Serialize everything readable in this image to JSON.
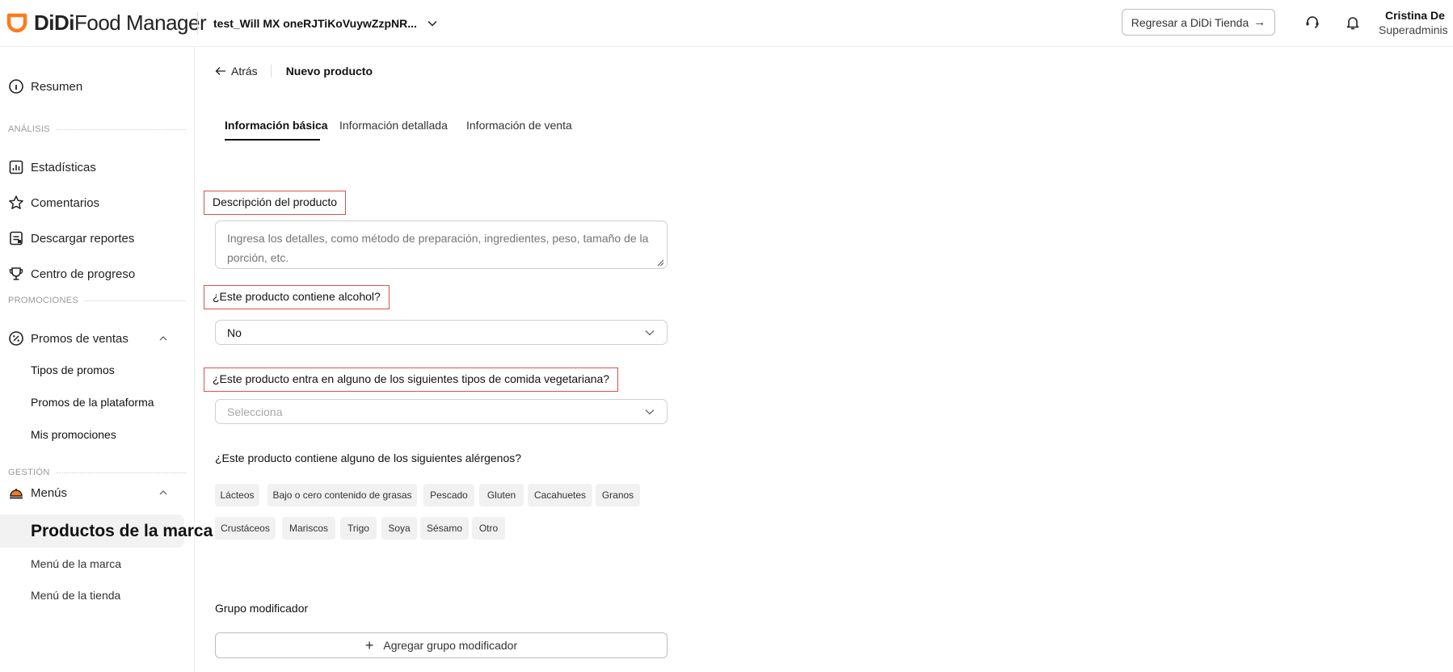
{
  "app": {
    "logo_part1": "DiDi",
    "logo_part2": "Food Manager",
    "brand_color": "#FF7A1A"
  },
  "header": {
    "store_name": "test_Will MX oneRJTiKoVuywZzpNR...",
    "back_store_label": "Regresar a DiDi Tienda",
    "back_store_arrow": "→",
    "user_name": "Cristina De",
    "user_role": "Superadminis"
  },
  "sidebar": {
    "resumen": "Resumen",
    "section_analisis": "ANÁLISIS",
    "estadisticas": "Estadísticas",
    "comentarios": "Comentarios",
    "descargar": "Descargar reportes",
    "centro": "Centro de progreso",
    "section_promociones": "PROMOCIONES",
    "promos_ventas": "Promos de ventas",
    "tipos_promos": "Tipos de promos",
    "promos_plataforma": "Promos de la plataforma",
    "mis_promociones": "Mis promociones",
    "section_gestion": "GESTIÓN",
    "menus": "Menús",
    "productos_marca": "Productos de la marca",
    "menu_marca": "Menú de la marca",
    "menu_tienda": "Menú de la tienda"
  },
  "breadcrumb": {
    "back": "Atrás",
    "current": "Nuevo producto"
  },
  "tabs": [
    {
      "label": "Información básica"
    },
    {
      "label": "Información detallada"
    },
    {
      "label": "Información de venta"
    }
  ],
  "form": {
    "description_label": "Descripción del producto",
    "description_placeholder": "Ingresa los detalles, como método de preparación, ingredientes, peso, tamaño de la porción, etc.",
    "alcohol_label": "¿Este producto contiene alcohol?",
    "alcohol_value": "No",
    "veg_label": "¿Este producto entra en alguno de los siguientes tipos de comida vegetariana?",
    "veg_placeholder": "Selecciona",
    "allergens_label": "¿Este producto contiene alguno de los siguientes alérgenos?",
    "allergens_row1": [
      "Lácteos",
      "Bajo o cero contenido de grasas",
      "Pescado",
      "Gluten",
      "Cacahuetes",
      "Granos"
    ],
    "allergens_row2": [
      "Crustáceos",
      "Mariscos",
      "Trigo",
      "Soya",
      "Sésamo",
      "Otro"
    ],
    "modifier_label": "Grupo modificador",
    "add_modifier": "Agregar grupo modificador",
    "add_icon": "+",
    "highlight_color": "#d9534f"
  }
}
